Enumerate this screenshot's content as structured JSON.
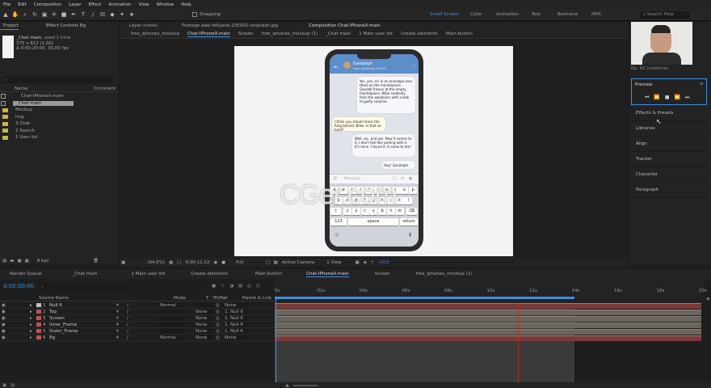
{
  "menu": [
    "File",
    "Edit",
    "Composition",
    "Layer",
    "Effect",
    "Animation",
    "View",
    "Window",
    "Help"
  ],
  "toolbar": {
    "snapping_label": "Snapping",
    "workspaces": [
      "Small Screen",
      "Color",
      "Animation",
      "Text",
      "Bashame",
      "MHC"
    ],
    "search_placeholder": "Search Help"
  },
  "project": {
    "tab_project": "Project",
    "tab_effects": "Effect Controls Bg",
    "item_name": "_Chat main",
    "used": ", used 1 time",
    "res": "375 x 812 (1,00)",
    "dur": "Δ 0:00:20:00, 30,00 fps",
    "col_name": "Name",
    "col_comment": "Comment",
    "items": [
      "Chat-IPhoneX-main",
      "_Chat main",
      "Mockup",
      "img",
      "3 Chat",
      "2 Search",
      "1 User list"
    ],
    "bpc": "8 bpc"
  },
  "viewer": {
    "tabs": [
      "Layer (none)",
      "Footage alex-fellyane-235002-unsplash.jpg",
      "Composition Chat-IPhoneX-main"
    ],
    "subtabs": [
      "free_iphonex_mockup",
      "Chat-IPhoneX-main",
      "Screen",
      "free_iphonex_mockup (1)",
      "_Chat main",
      "1 Main user list",
      "Create elements",
      "Main button"
    ],
    "zoom": "(94,5%)",
    "timecode": "0:00:11:12",
    "quality": "Full",
    "camera": "Active Camera",
    "view": "1 View",
    "exposure": "+0,0"
  },
  "phone": {
    "contact_name": "Gandalph",
    "last_seen": "seen yesterday at 6:16",
    "messages": [
      {
        "side": "right",
        "text": "Yes, yes, it's in an envelope over there on the mantelpiece. Gandalf frowns at the empty mantelpiece. Bilbo suddenly feels the weakness with a look of guilty surprise."
      },
      {
        "side": "left",
        "text": "I think you should leave the Ring behind, Bilbo. Is that so hard?"
      },
      {
        "side": "right",
        "text": "Well, no...and yes. Now it comes to it, I don't feel like parting with it. It's mine. I found it. It came to me!"
      },
      {
        "side": "right",
        "text": "Hey! Gandalph"
      }
    ],
    "message_placeholder": "Message",
    "keys_row1": [
      "q",
      "w",
      "e",
      "r",
      "t",
      "y",
      "u",
      "i",
      "o",
      "p"
    ],
    "keys_row2": [
      "a",
      "s",
      "d",
      "f",
      "g",
      "h",
      "j",
      "k",
      "l"
    ],
    "keys_row3": [
      "z",
      "x",
      "c",
      "v",
      "b",
      "n",
      "m"
    ],
    "key_123": "123",
    "key_space": "space",
    "key_return": "return"
  },
  "watermark": "CGer.com",
  "right_panel": {
    "webcam_caption": "Ep. 50 (realtime)",
    "preview_title": "Preview",
    "items": [
      "Effects & Presets",
      "Libraries",
      "Align",
      "Tracker",
      "Character",
      "Paragraph"
    ]
  },
  "timeline": {
    "tabs": [
      "Render Queue",
      "_Chat main",
      "1 Main user list",
      "Create elements",
      "Main button",
      "Chat-IPhoneX-main",
      "Screen",
      "free_iphonex_mockup (1)"
    ],
    "timecode": "0:00:00:00",
    "col_source": "Source Name",
    "col_mode": "Mode",
    "col_t": "T",
    "col_trkmat": "TrkMat",
    "col_parent": "Parent & Link",
    "layers": [
      {
        "num": "1",
        "name": "Null 6",
        "mode": "Normal",
        "trk": "",
        "parent": "None"
      },
      {
        "num": "2",
        "name": "Top",
        "mode": "",
        "trk": "None",
        "parent": "1. Null 6"
      },
      {
        "num": "3",
        "name": "Screen",
        "mode": "",
        "trk": "None",
        "parent": "1. Null 6"
      },
      {
        "num": "4",
        "name": "Inner_Frame",
        "mode": "",
        "trk": "None",
        "parent": "1. Null 6"
      },
      {
        "num": "5",
        "name": "Outer_Frame",
        "mode": "",
        "trk": "None",
        "parent": "1. Null 6"
      },
      {
        "num": "6",
        "name": "Bg",
        "mode": "Normal",
        "trk": "None",
        "parent": "None"
      }
    ],
    "ruler": [
      "0s",
      "02s",
      "04s",
      "06s",
      "08s",
      "10s",
      "12s",
      "14s",
      "16s",
      "18s",
      "20s"
    ]
  },
  "colors": {
    "accent": "#3d8fe6",
    "bar": "#6b655a",
    "workarea": "#3e3e3e",
    "phone_bg": "#dfe3ea"
  }
}
